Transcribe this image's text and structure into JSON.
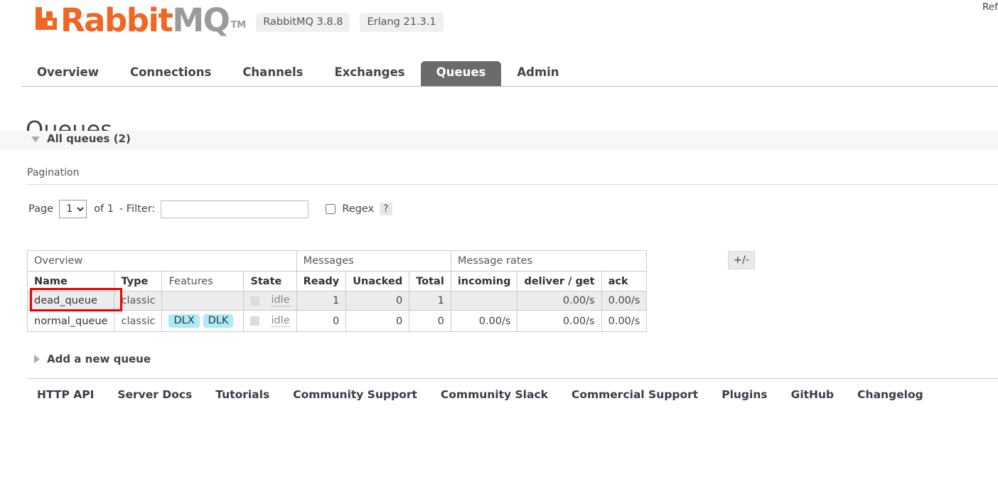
{
  "header": {
    "logo_rabbit": "Rabbit",
    "logo_mq": "MQ",
    "logo_tm": "TM",
    "rabbitmq_version": "RabbitMQ 3.8.8",
    "erlang_version": "Erlang 21.3.1",
    "refresh_text": "Ref"
  },
  "nav": {
    "tabs": [
      {
        "label": "Overview",
        "active": false
      },
      {
        "label": "Connections",
        "active": false
      },
      {
        "label": "Channels",
        "active": false
      },
      {
        "label": "Exchanges",
        "active": false
      },
      {
        "label": "Queues",
        "active": true
      },
      {
        "label": "Admin",
        "active": false
      }
    ]
  },
  "page": {
    "title": "Queues",
    "all_queues_label": "All queues (2)"
  },
  "pagination": {
    "section_label": "Pagination",
    "page_label": "Page",
    "page_value": "1",
    "page_options": [
      "1"
    ],
    "of_label": "of 1",
    "filter_label": "- Filter:",
    "filter_value": "",
    "filter_placeholder": "",
    "regex_label": "Regex",
    "regex_checked": false,
    "help_label": "?"
  },
  "table": {
    "group_headers": [
      {
        "label": "Overview",
        "span": 4
      },
      {
        "label": "Messages",
        "span": 3
      },
      {
        "label": "Message rates",
        "span": 3
      }
    ],
    "columns": [
      {
        "label": "Name",
        "bold": true
      },
      {
        "label": "Type",
        "bold": true
      },
      {
        "label": "Features",
        "bold": false
      },
      {
        "label": "State",
        "bold": true
      },
      {
        "label": "Ready",
        "bold": true
      },
      {
        "label": "Unacked",
        "bold": true
      },
      {
        "label": "Total",
        "bold": true
      },
      {
        "label": "incoming",
        "bold": true
      },
      {
        "label": "deliver / get",
        "bold": true
      },
      {
        "label": "ack",
        "bold": true
      }
    ],
    "rows": [
      {
        "name": "dead_queue",
        "type": "classic",
        "features": [],
        "state": "idle",
        "ready": "1",
        "unacked": "0",
        "total": "1",
        "incoming": "",
        "deliver_get": "0.00/s",
        "ack": "0.00/s"
      },
      {
        "name": "normal_queue",
        "type": "classic",
        "features": [
          "DLX",
          "DLK"
        ],
        "state": "idle",
        "ready": "0",
        "unacked": "0",
        "total": "0",
        "incoming": "0.00/s",
        "deliver_get": "0.00/s",
        "ack": "0.00/s"
      }
    ],
    "toggle_columns_label": "+/-"
  },
  "add_queue": {
    "label": "Add a new queue"
  },
  "footer": {
    "links": [
      "HTTP API",
      "Server Docs",
      "Tutorials",
      "Community Support",
      "Community Slack",
      "Commercial Support",
      "Plugins",
      "GitHub",
      "Changelog"
    ]
  },
  "colors": {
    "brand_orange": "#f26522",
    "active_tab_bg": "#6b6b6b",
    "tag_bg": "#aeeaf7",
    "highlight_red": "#ee0000"
  }
}
